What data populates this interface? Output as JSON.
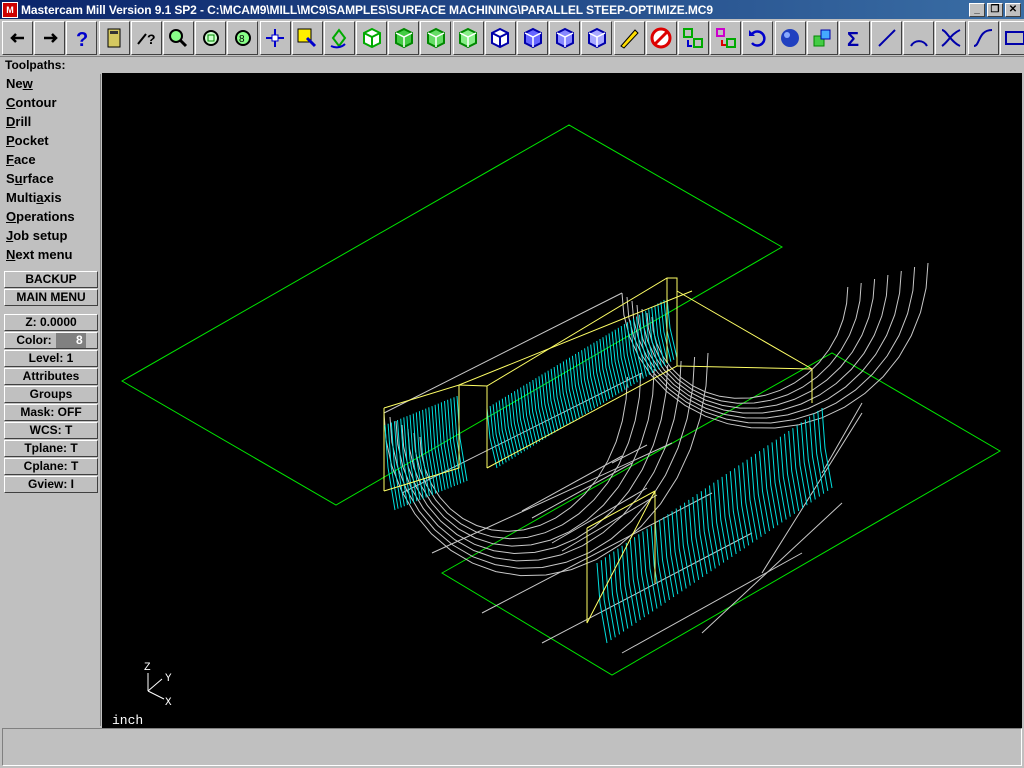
{
  "titlebar": {
    "title": "Mastercam Mill Version 9.1 SP2 - C:\\MCAM9\\MILL\\MC9\\SAMPLES\\SURFACE MACHINING\\PARALLEL STEEP-OPTIMIZE.MC9",
    "min": "_",
    "restore": "❐",
    "close": "✕"
  },
  "toolbar": {
    "icons": [
      "back-arrow-icon",
      "forward-arrow-icon",
      "help-icon",
      "calculator-icon",
      "analyze-icon",
      "zoom-window-icon",
      "zoom-out-icon",
      "zoom-previous-icon",
      "pan-icon",
      "select-icon",
      "rotate-icon",
      "view-top-icon",
      "view-front-icon",
      "view-side-icon",
      "view-iso-icon",
      "cube-top-icon",
      "cube-front-icon",
      "cube-side-icon",
      "cube-iso-icon",
      "erase-icon",
      "delete-icon",
      "transform-icon",
      "translate-icon",
      "undo-icon",
      "shade-icon",
      "solid-icon",
      "sum-icon",
      "line-icon",
      "arc-icon",
      "fillet-icon",
      "spline-icon",
      "rectangle-icon"
    ]
  },
  "header": {
    "label": "Toolpaths:"
  },
  "menu": {
    "items": [
      {
        "pre": "Ne",
        "u": "w",
        "post": ""
      },
      {
        "pre": "",
        "u": "C",
        "post": "ontour"
      },
      {
        "pre": "",
        "u": "D",
        "post": "rill"
      },
      {
        "pre": "",
        "u": "P",
        "post": "ocket"
      },
      {
        "pre": "",
        "u": "F",
        "post": "ace"
      },
      {
        "pre": "S",
        "u": "u",
        "post": "rface"
      },
      {
        "pre": "Multi",
        "u": "a",
        "post": "xis"
      },
      {
        "pre": "",
        "u": "O",
        "post": "perations"
      },
      {
        "pre": "",
        "u": "J",
        "post": "ob setup"
      },
      {
        "pre": "",
        "u": "N",
        "post": "ext menu"
      }
    ],
    "backup": "BACKUP",
    "main_menu": "MAIN MENU",
    "z": "Z:  0.0000",
    "color_label": "Color:",
    "color_value": "8",
    "level": "Level:  1",
    "attributes": "Attributes",
    "groups": "Groups",
    "mask": "Mask:  OFF",
    "wcs": "WCS:   T",
    "tplane": "Tplane:  T",
    "cplane": "Cplane:  T",
    "gview": "Gview:   I"
  },
  "viewport": {
    "units": "inch",
    "axis_z": "Z",
    "axis_y": "Y",
    "axis_x": "X"
  },
  "colors": {
    "green": "#00e600",
    "yellow": "#ffff66",
    "cyan": "#00e0e0",
    "wire": "#d0d0d0"
  }
}
